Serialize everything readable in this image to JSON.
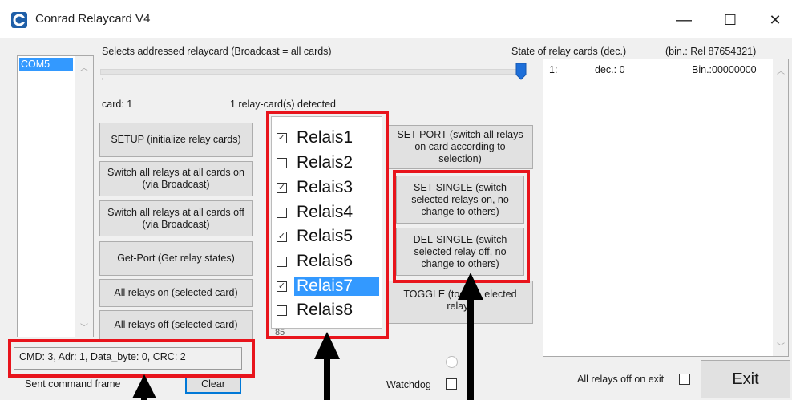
{
  "window": {
    "title": "Conrad Relaycard V4",
    "minimize": "—",
    "maximize": "☐",
    "close": "✕"
  },
  "ports": {
    "items": [
      "COM5"
    ]
  },
  "address": {
    "label": "Selects addressed relaycard (Broadcast =  all cards)",
    "tick": "'",
    "card": "card: 1",
    "detected": "1 relay-card(s) detected"
  },
  "state": {
    "header": "State of relay cards (dec.)",
    "bin_header": "(bin.: Rel 87654321)",
    "rows": [
      {
        "card": "1:",
        "dec": "dec.: 0",
        "bin": "Bin.:00000000"
      }
    ]
  },
  "buttons": {
    "setup": "SETUP (initialize relay cards)",
    "all_on_broadcast": "Switch all relays at all cards on (via Broadcast)",
    "all_off_broadcast": "Switch all relays at all cards off (via Broadcast)",
    "get_port": "Get-Port (Get relay states)",
    "all_on_card": "All relays on (selected card)",
    "all_off_card": "All relays off (selected card)",
    "set_port": "SET-PORT (switch all relays on card according to selection)",
    "set_single": "SET-SINGLE (switch selected relays on, no change to others)",
    "del_single": "DEL-SINGLE (switch selected relay off, no change to others)",
    "toggle_left": "TOGGLE (tog",
    "toggle_right": "elected",
    "toggle_line2": "relays",
    "clear": "Clear",
    "exit": "Exit"
  },
  "relays": [
    {
      "label": "Relais1",
      "checked": true,
      "selected": false
    },
    {
      "label": "Relais2",
      "checked": false,
      "selected": false
    },
    {
      "label": "Relais3",
      "checked": true,
      "selected": false
    },
    {
      "label": "Relais4",
      "checked": false,
      "selected": false
    },
    {
      "label": "Relais5",
      "checked": true,
      "selected": false
    },
    {
      "label": "Relais6",
      "checked": false,
      "selected": false
    },
    {
      "label": "Relais7",
      "checked": true,
      "selected": true
    },
    {
      "label": "Relais8",
      "checked": false,
      "selected": false
    }
  ],
  "below_relays": "85",
  "status": {
    "command": "CMD: 3,  Adr: 1,  Data_byte: 0,  CRC: 2",
    "sent_label": "Sent command frame",
    "watchdog": "Watchdog",
    "all_off_on_exit": "All relays off on exit"
  },
  "colors": {
    "highlight": "#e8141c",
    "selection": "#3399ff",
    "window_bg": "#f0f0f0"
  }
}
